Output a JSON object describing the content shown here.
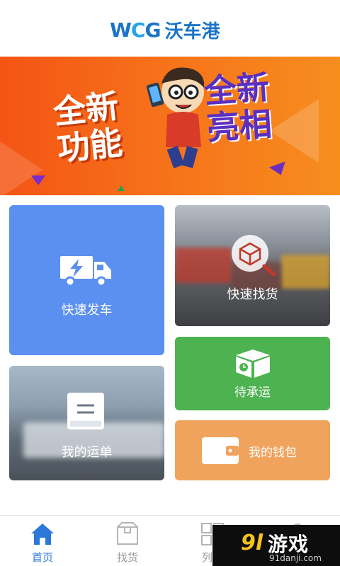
{
  "header": {
    "logo_mark_w": "W",
    "logo_mark_c": "C",
    "logo_mark_g": "G",
    "logo_text": "沃车港"
  },
  "banner": {
    "left_line1": "全新",
    "left_line2": "功能",
    "right_line1": "全新",
    "right_line2": "亮相"
  },
  "tiles": {
    "fast_ship": "快速发车",
    "find_goods": "快速找货",
    "pending": "待承运",
    "my_orders": "我的运单",
    "wallet": "我的钱包"
  },
  "tabbar": {
    "items": [
      {
        "label": "首页",
        "icon": "home-icon",
        "active": true
      },
      {
        "label": "找货",
        "icon": "package-icon",
        "active": false
      },
      {
        "label": "列表",
        "icon": "grid-icon",
        "active": false
      },
      {
        "label": "",
        "icon": "settings-icon",
        "active": false
      }
    ]
  },
  "watermark": {
    "logo": "9l",
    "name": "游戏",
    "url": "91danji.com"
  },
  "colors": {
    "brand_blue": "#1b74c9",
    "tab_active": "#2b78d8",
    "tile_blue": "#5b8ff0",
    "tile_green": "#4db250",
    "tile_orange": "#f0a35c"
  }
}
